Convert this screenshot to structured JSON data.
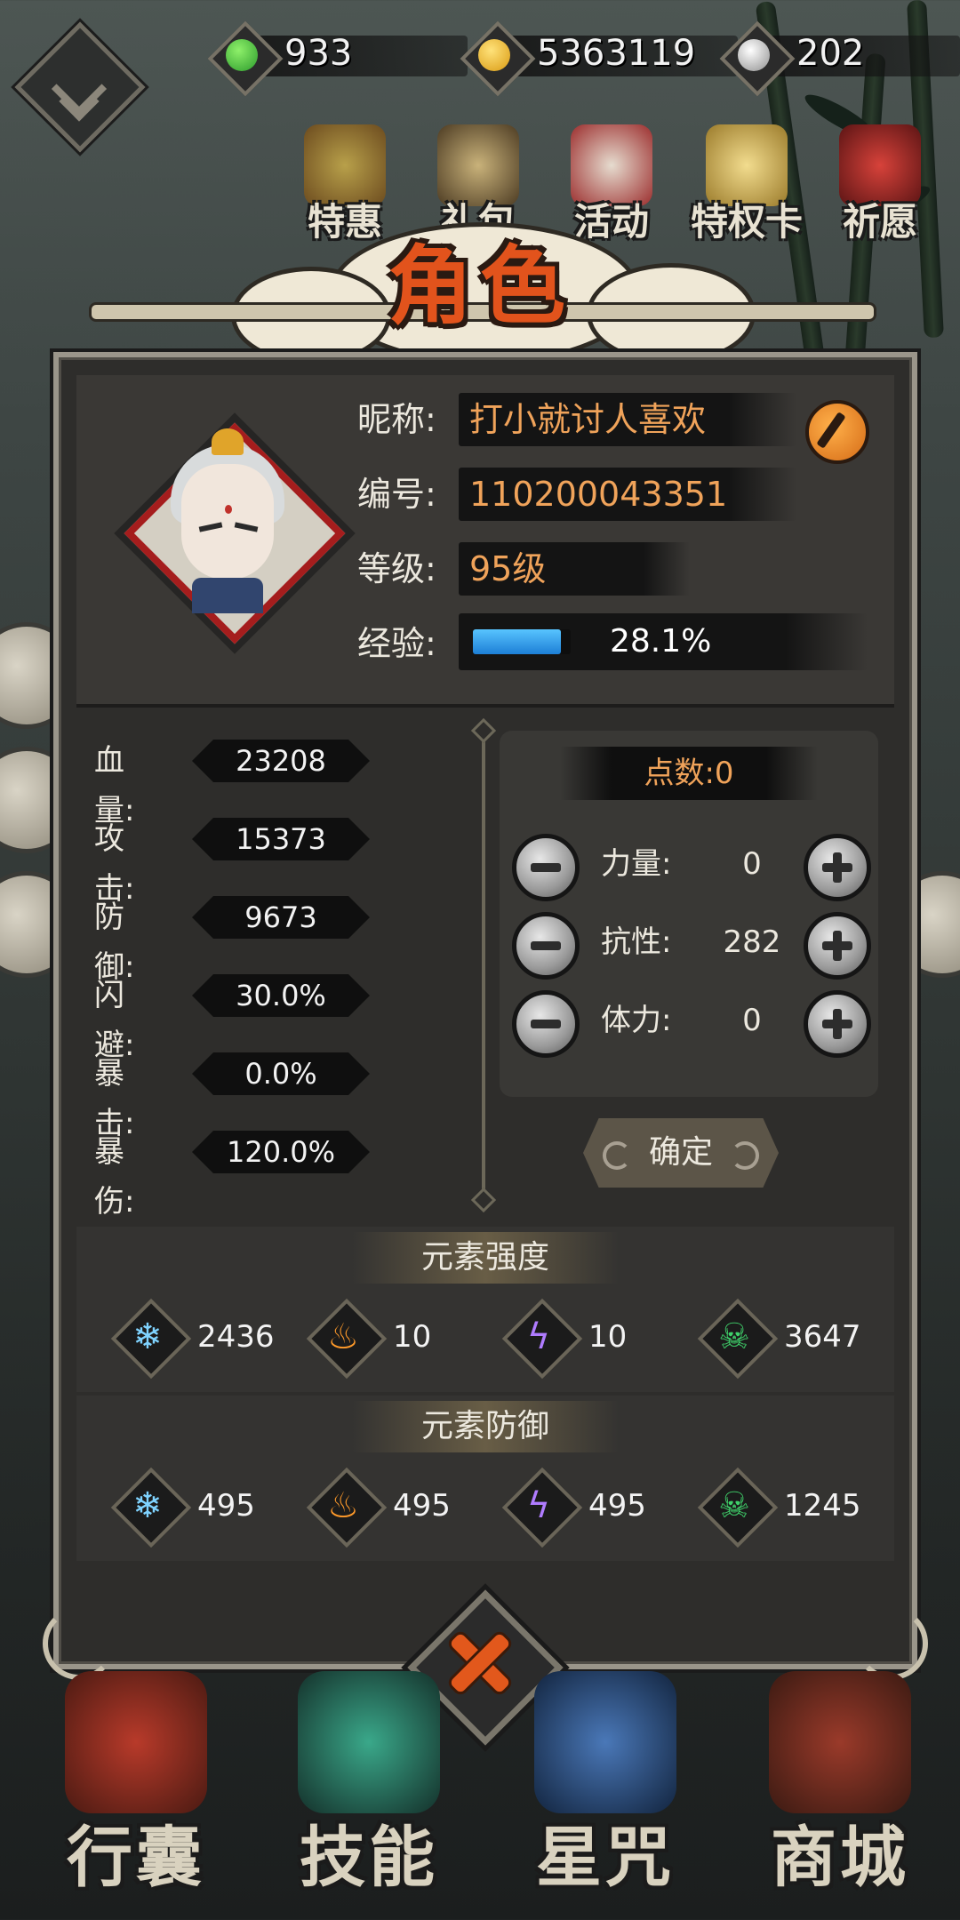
{
  "currency": [
    {
      "icon": "green-flame-icon",
      "value": "933",
      "color": "#3bbd3b"
    },
    {
      "icon": "gold-coin-icon",
      "value": "5363119",
      "color": "#f3b525"
    },
    {
      "icon": "silver-swirl-icon",
      "value": "202",
      "color": "#cfcfcf"
    }
  ],
  "top_menu": [
    {
      "icon": "treasure-chest-icon",
      "label": "特惠"
    },
    {
      "icon": "samurai-helmet-icon",
      "label": "礼包"
    },
    {
      "icon": "drum-icon",
      "label": "活动"
    },
    {
      "icon": "privilege-card-icon",
      "label": "特权卡"
    },
    {
      "icon": "torii-gate-icon",
      "label": "祈愿"
    }
  ],
  "panel_title": "角色",
  "profile": {
    "nickname_label": "昵称:",
    "nickname": "打小就讨人喜欢",
    "id_label": "编号:",
    "id": "110200043351",
    "level_label": "等级:",
    "level": "95级",
    "exp_label": "经验:",
    "exp_text": "28.1%",
    "exp_fraction": 0.281
  },
  "stats": [
    {
      "label": "血量:",
      "value": "23208"
    },
    {
      "label": "攻击:",
      "value": "15373"
    },
    {
      "label": "防御:",
      "value": "9673"
    },
    {
      "label": "闪避:",
      "value": "30.0%"
    },
    {
      "label": "暴击:",
      "value": "0.0%"
    },
    {
      "label": "暴伤:",
      "value": "120.0%"
    }
  ],
  "points": {
    "header": "点数:0",
    "attributes": [
      {
        "label": "力量:",
        "value": "0"
      },
      {
        "label": "抗性:",
        "value": "282"
      },
      {
        "label": "体力:",
        "value": "0"
      }
    ],
    "confirm_label": "确定"
  },
  "element_strength": {
    "title": "元素强度",
    "items": [
      {
        "icon": "ice-icon",
        "value": "2436"
      },
      {
        "icon": "fire-icon",
        "value": "10"
      },
      {
        "icon": "lightning-icon",
        "value": "10"
      },
      {
        "icon": "poison-skull-icon",
        "value": "3647"
      }
    ]
  },
  "element_defense": {
    "title": "元素防御",
    "items": [
      {
        "icon": "ice-icon",
        "value": "495"
      },
      {
        "icon": "fire-icon",
        "value": "495"
      },
      {
        "icon": "lightning-icon",
        "value": "495"
      },
      {
        "icon": "poison-skull-icon",
        "value": "1245"
      }
    ]
  },
  "bottom_nav": [
    {
      "icon": "bag-icon",
      "label": "行囊"
    },
    {
      "icon": "dragon-icon",
      "label": "技能"
    },
    {
      "icon": "star-chart-icon",
      "label": "星咒"
    },
    {
      "icon": "abacus-icon",
      "label": "商城"
    }
  ]
}
